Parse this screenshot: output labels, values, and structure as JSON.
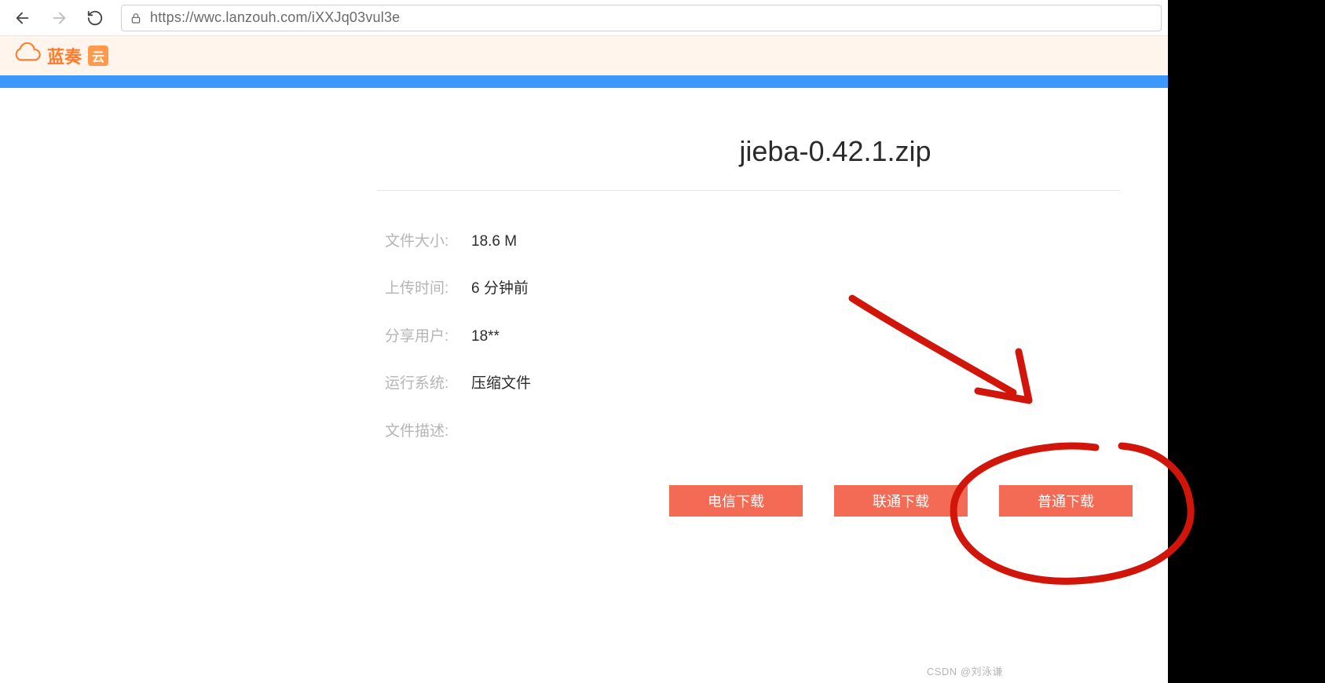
{
  "browser": {
    "url": "https://wwc.lanzouh.com/iXXJq03vul3e"
  },
  "brand": {
    "name": "蓝奏",
    "badge": "云"
  },
  "file": {
    "title": "jieba-0.42.1.zip",
    "meta": {
      "size_label": "文件大小:",
      "size_value": "18.6 M",
      "time_label": "上传时间:",
      "time_value": "6 分钟前",
      "user_label": "分享用户:",
      "user_value": "18**",
      "os_label": "运行系统:",
      "os_value": "压缩文件",
      "desc_label": "文件描述:",
      "desc_value": ""
    }
  },
  "downloads": {
    "telecom": "电信下载",
    "unicom": "联通下载",
    "normal": "普通下载"
  },
  "watermark": "CSDN @刘泳谦",
  "colors": {
    "accent_orange": "#ff7a2a",
    "blue_strip": "#3b99fc",
    "button_red": "#f36b55",
    "brand_bg": "#fff5ed"
  }
}
